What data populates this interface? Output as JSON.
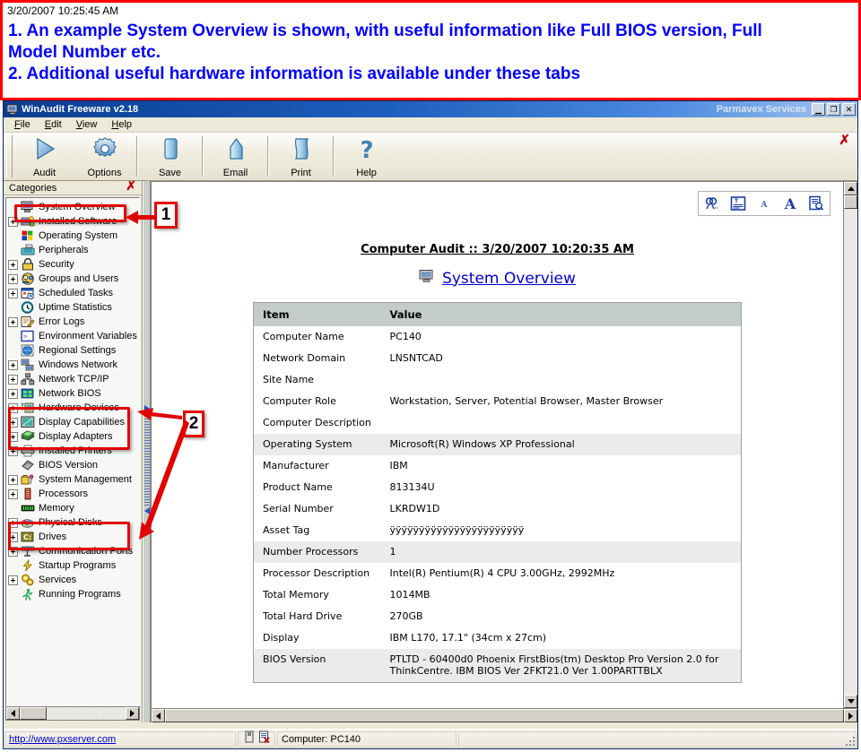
{
  "annotation": {
    "timestamp": "3/20/2007 10:25:45 AM",
    "line1": "1. An example System Overview is shown, with useful information like Full BIOS version, Full",
    "line1b": "Model Number etc.",
    "line2": "2. Additional useful hardware information is available under these tabs",
    "callout1": "1",
    "callout2": "2",
    "accent_color": "#ff0000",
    "text_color": "#0000ff"
  },
  "window": {
    "title": "WinAudit Freeware v2.18",
    "title_right": "Parmavex Services",
    "icon": "computer-icon",
    "buttons": {
      "minimize": "_",
      "maximize": "□",
      "close": "✕"
    }
  },
  "menu": {
    "items": [
      {
        "label": "File",
        "mnemonic": "F"
      },
      {
        "label": "Edit",
        "mnemonic": "E"
      },
      {
        "label": "View",
        "mnemonic": "V"
      },
      {
        "label": "Help",
        "mnemonic": "H"
      }
    ]
  },
  "toolbar": {
    "close_x": "✗",
    "buttons": [
      {
        "label": "Audit",
        "icon": "play-triangle-icon"
      },
      {
        "label": "Options",
        "icon": "gear-icon"
      },
      {
        "label": "Save",
        "icon": "save-document-icon"
      },
      {
        "label": "Email",
        "icon": "envelope-icon"
      },
      {
        "label": "Print",
        "icon": "printer-page-icon"
      },
      {
        "label": "Help",
        "icon": "question-mark-icon"
      }
    ]
  },
  "categories": {
    "header": "Categories",
    "close_x": "✗",
    "items": [
      {
        "label": "System Overview",
        "icon": "monitor-icon",
        "expandable": false,
        "selected": true
      },
      {
        "label": "Installed Software",
        "icon": "software-box-icon",
        "expandable": true,
        "selected": false
      },
      {
        "label": "Operating System",
        "icon": "windows-flag-icon",
        "expandable": false,
        "selected": false
      },
      {
        "label": "Peripherals",
        "icon": "keyboard-icon",
        "expandable": false,
        "selected": false
      },
      {
        "label": "Security",
        "icon": "padlock-icon",
        "expandable": true,
        "selected": false
      },
      {
        "label": "Groups and Users",
        "icon": "users-icon",
        "expandable": true,
        "selected": false
      },
      {
        "label": "Scheduled Tasks",
        "icon": "calendar-clock-icon",
        "expandable": true,
        "selected": false
      },
      {
        "label": "Uptime Statistics",
        "icon": "clock-icon",
        "expandable": false,
        "selected": false
      },
      {
        "label": "Error Logs",
        "icon": "notepad-pencil-icon",
        "expandable": true,
        "selected": false
      },
      {
        "label": "Environment Variables",
        "icon": "console-prompt-icon",
        "expandable": false,
        "selected": false
      },
      {
        "label": "Regional Settings",
        "icon": "globe-icon",
        "expandable": false,
        "selected": false
      },
      {
        "label": "Windows Network",
        "icon": "network-computer-icon",
        "expandable": true,
        "selected": false
      },
      {
        "label": "Network TCP/IP",
        "icon": "network-nodes-icon",
        "expandable": true,
        "selected": false
      },
      {
        "label": "Network BIOS",
        "icon": "network-puzzle-icon",
        "expandable": true,
        "selected": false
      },
      {
        "label": "Hardware Devices",
        "icon": "chip-card-icon",
        "expandable": true,
        "selected": false
      },
      {
        "label": "Display Capabilities",
        "icon": "display-screen-icon",
        "expandable": true,
        "selected": false
      },
      {
        "label": "Display Adapters",
        "icon": "graphics-card-icon",
        "expandable": true,
        "selected": false
      },
      {
        "label": "Installed Printers",
        "icon": "printer-icon",
        "expandable": true,
        "selected": false
      },
      {
        "label": "BIOS Version",
        "icon": "bios-chip-icon",
        "expandable": false,
        "selected": false
      },
      {
        "label": "System Management",
        "icon": "toolbox-icon",
        "expandable": true,
        "selected": false
      },
      {
        "label": "Processors",
        "icon": "cpu-icon",
        "expandable": true,
        "selected": false
      },
      {
        "label": "Memory",
        "icon": "memory-ram-icon",
        "expandable": false,
        "selected": false
      },
      {
        "label": "Physical Disks",
        "icon": "physical-disk-icon",
        "expandable": true,
        "selected": false
      },
      {
        "label": "Drives",
        "icon": "drive-c-icon",
        "expandable": true,
        "selected": false
      },
      {
        "label": "Communication Ports",
        "icon": "comm-port-icon",
        "expandable": true,
        "selected": false
      },
      {
        "label": "Startup Programs",
        "icon": "lightning-bolt-icon",
        "expandable": false,
        "selected": false
      },
      {
        "label": "Services",
        "icon": "gears-icon",
        "expandable": true,
        "selected": false
      },
      {
        "label": "Running Programs",
        "icon": "running-person-icon",
        "expandable": false,
        "selected": false
      }
    ]
  },
  "report": {
    "format_tools": [
      {
        "name": "find-next-icon"
      },
      {
        "name": "text-box-icon"
      },
      {
        "name": "font-small-icon"
      },
      {
        "name": "font-large-icon"
      },
      {
        "name": "print-preview-icon"
      }
    ],
    "title": "Computer Audit :: 3/20/2007 10:20:35 AM",
    "section_icon": "monitor-icon",
    "section_title": "System Overview",
    "columns": [
      "Item",
      "Value"
    ],
    "rows": [
      {
        "item": "Computer Name",
        "value": "PC140"
      },
      {
        "item": "Network Domain",
        "value": "LNSNTCAD"
      },
      {
        "item": "Site Name",
        "value": ""
      },
      {
        "item": "Computer Role",
        "value": "Workstation, Server, Potential Browser, Master Browser"
      },
      {
        "item": "Computer Description",
        "value": ""
      },
      {
        "item": "Operating System",
        "value": "Microsoft(R) Windows XP Professional"
      },
      {
        "item": "Manufacturer",
        "value": "IBM"
      },
      {
        "item": "Product Name",
        "value": "813134U"
      },
      {
        "item": "Serial Number",
        "value": "LKRDW1D"
      },
      {
        "item": "Asset Tag",
        "value": "ÿÿÿÿÿÿÿÿÿÿÿÿÿÿÿÿÿÿÿÿÿÿÿ"
      },
      {
        "item": "Number Processors",
        "value": "1"
      },
      {
        "item": "Processor Description",
        "value": "Intel(R) Pentium(R) 4 CPU 3.00GHz, 2992MHz"
      },
      {
        "item": "Total Memory",
        "value": "1014MB"
      },
      {
        "item": "Total Hard Drive",
        "value": "270GB"
      },
      {
        "item": "Display",
        "value": "IBM L170, 17.1\" (34cm x 27cm)"
      },
      {
        "item": "BIOS Version",
        "value": "PTLTD - 60400d0 Phoenix FirstBios(tm) Desktop Pro Version 2.0 for ThinkCentre. IBM BIOS Ver 2FKT21.0 Ver 1.00PARTTBLX"
      }
    ]
  },
  "statusbar": {
    "link": "http://www.pxserver.com",
    "icon1": "save-disk-icon",
    "icon2": "export-excel-icon",
    "computer": "Computer: PC140"
  }
}
